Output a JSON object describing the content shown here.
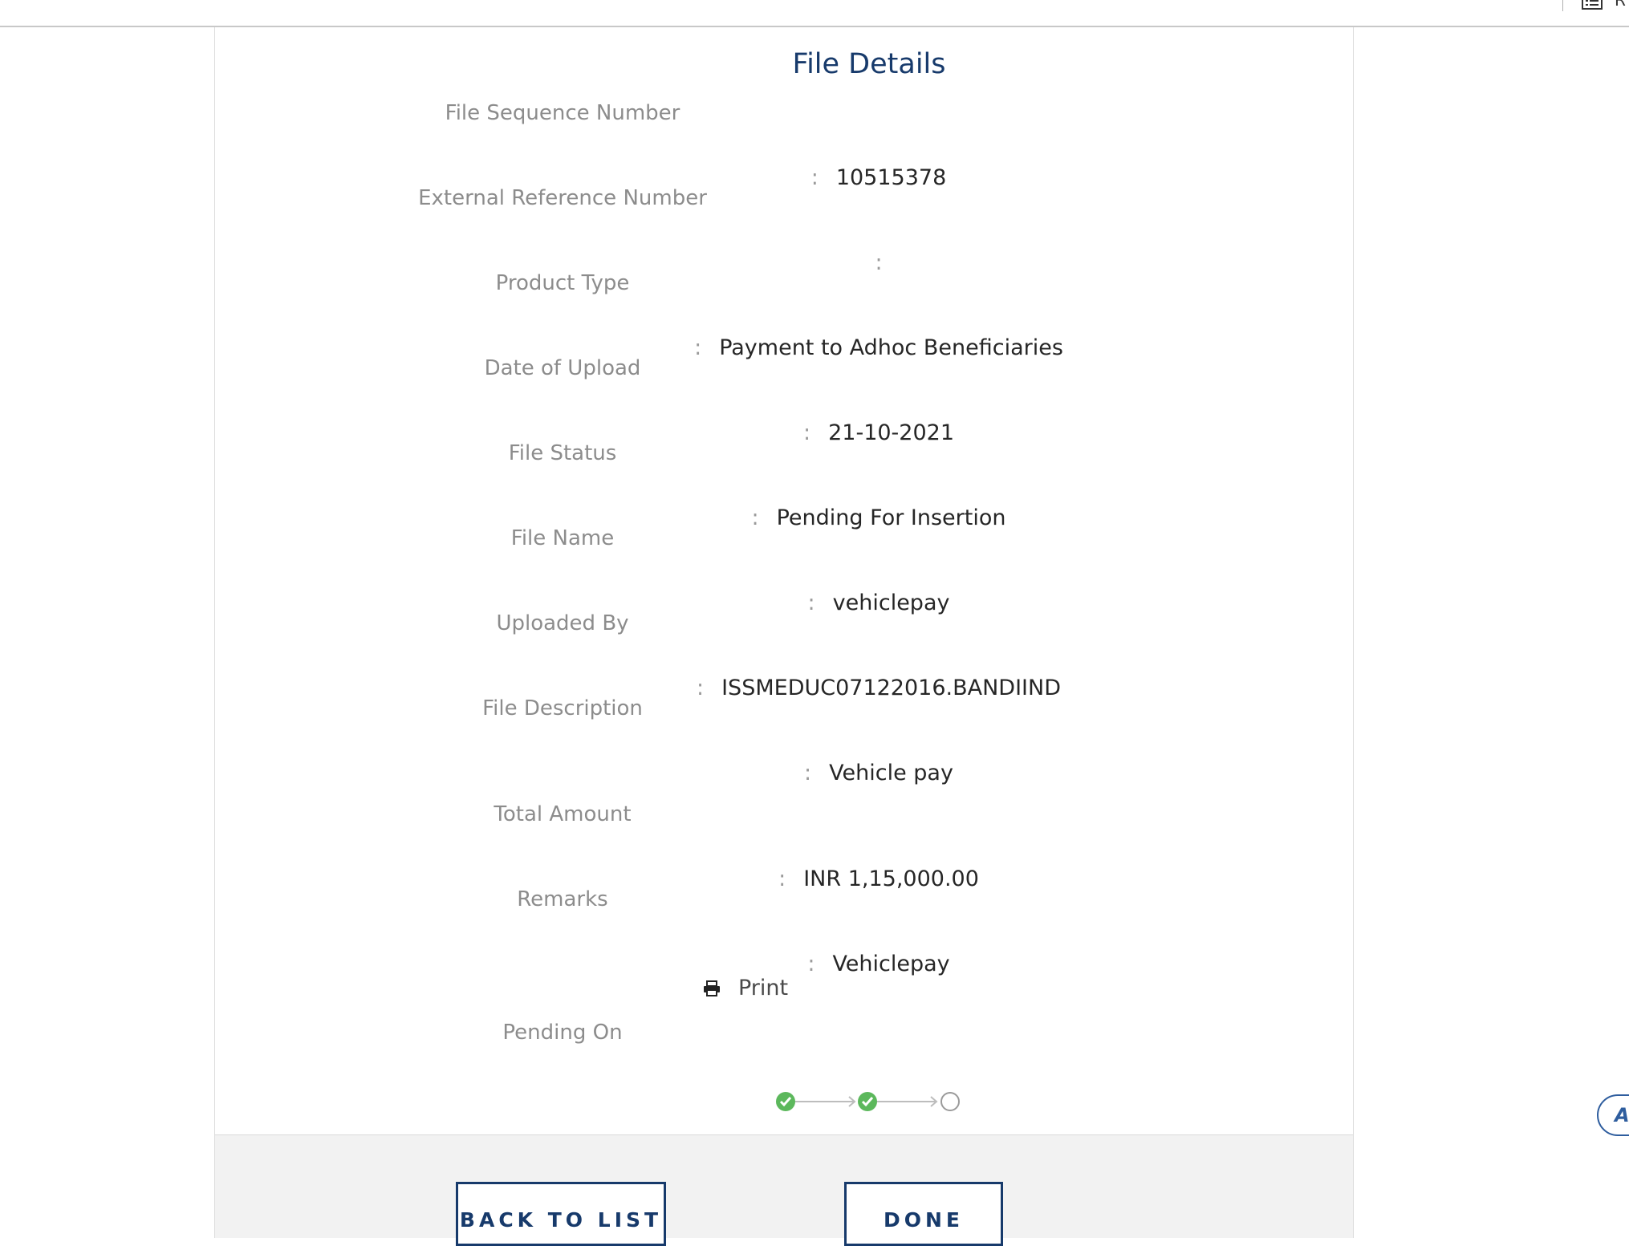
{
  "header": {
    "title": "File Details",
    "corner_glyph": "R"
  },
  "fields": [
    {
      "label": "File Sequence Number",
      "value": ""
    },
    {
      "label": "External Reference Number",
      "value": "10515378"
    },
    {
      "label": "Product Type",
      "value": ""
    },
    {
      "label": "Date of Upload",
      "value": "Payment to Adhoc Beneficiaries"
    },
    {
      "label": "File Status",
      "value": "21-10-2021"
    },
    {
      "label": "File Name",
      "value": "Pending For Insertion"
    },
    {
      "label": "Uploaded By",
      "value": "vehiclepay"
    },
    {
      "label": "File Description",
      "value": "ISSMEDUC07122016.BANDIIND"
    },
    {
      "label": "Total Amount",
      "value": "Vehicle pay"
    },
    {
      "label": "Remarks",
      "value": "INR 1,15,000.00"
    },
    {
      "label": "Pending On",
      "value": "Vehiclepay"
    }
  ],
  "colon": ":",
  "print": {
    "label": "Print",
    "icon": "printer-icon"
  },
  "workflow": {
    "steps": [
      {
        "state": "completed",
        "icon": "check-circle-icon"
      },
      {
        "state": "completed",
        "icon": "check-circle-icon"
      },
      {
        "state": "pending",
        "icon": "empty-circle-icon"
      }
    ]
  },
  "buttons": {
    "back": "BACK TO LIST",
    "done": "DONE"
  },
  "side_widget": {
    "label": "A"
  },
  "colors": {
    "title": "#173a6b",
    "label": "#8c8c8c",
    "value": "#262626",
    "step_done": "#5cb85c",
    "step_pending": "#9a9a9a",
    "button_border": "#173a6b",
    "footer_bg": "#f2f2f2"
  }
}
